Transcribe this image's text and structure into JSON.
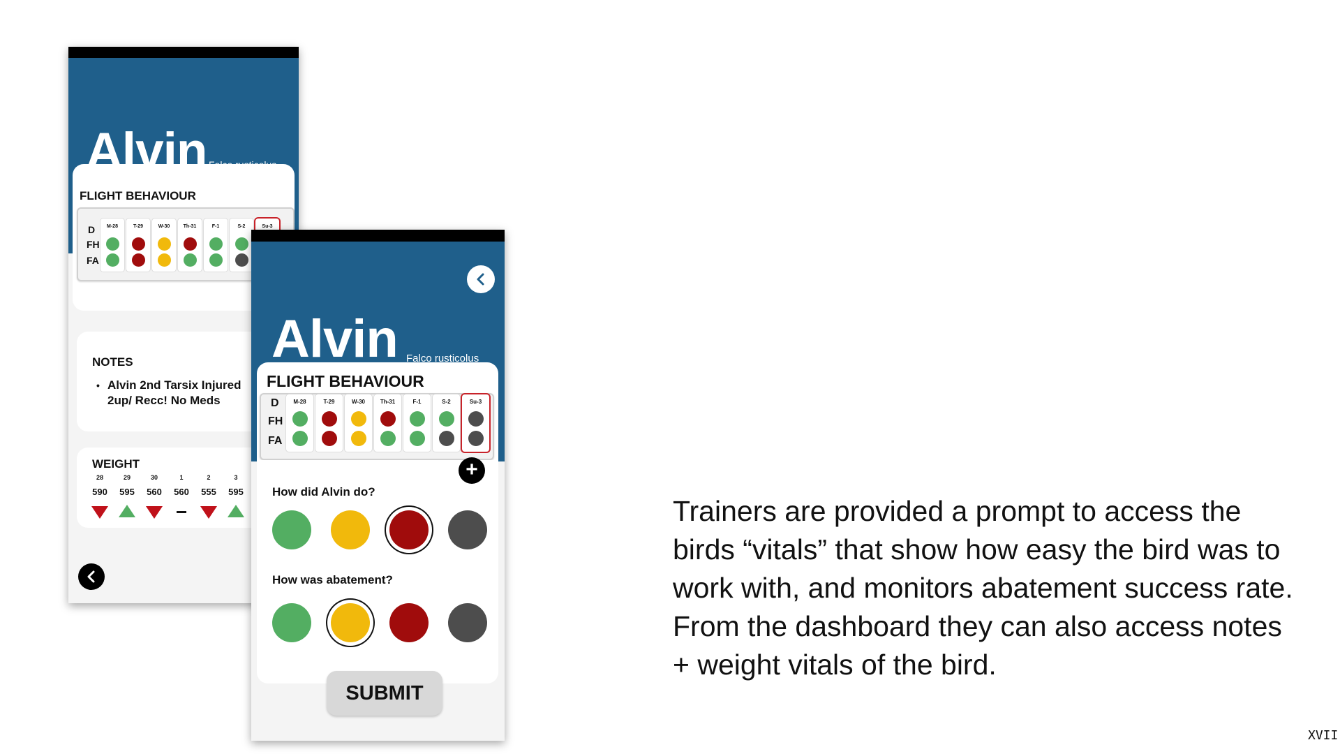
{
  "back_screen": {
    "bird_name": "Alvin",
    "scientific_name": "Falco rusticolus",
    "flight_behaviour": {
      "title": "FLIGHT BEHAVIOUR",
      "row_labels": [
        "D",
        "FH",
        "FA"
      ],
      "days": [
        {
          "label": "M-28",
          "fh": "green",
          "fa": "green"
        },
        {
          "label": "T-29",
          "fh": "red",
          "fa": "red"
        },
        {
          "label": "W-30",
          "fh": "yellow",
          "fa": "yellow"
        },
        {
          "label": "Th-31",
          "fh": "red",
          "fa": "green"
        },
        {
          "label": "F-1",
          "fh": "green",
          "fa": "green"
        },
        {
          "label": "S-2",
          "fh": "green",
          "fa": "gray"
        },
        {
          "label": "Su-3",
          "fh": "gray",
          "fa": "gray"
        }
      ]
    },
    "notes": {
      "title": "NOTES",
      "items": [
        "Alvin 2nd Tarsix Injured 2up/ Recc! No Meds"
      ]
    },
    "weight": {
      "title": "WEIGHT",
      "entries": [
        {
          "day": "28",
          "value": "590",
          "trend": "down"
        },
        {
          "day": "29",
          "value": "595",
          "trend": "up"
        },
        {
          "day": "30",
          "value": "560",
          "trend": "down"
        },
        {
          "day": "1",
          "value": "560",
          "trend": "same"
        },
        {
          "day": "2",
          "value": "555",
          "trend": "down"
        },
        {
          "day": "3",
          "value": "595",
          "trend": "up"
        }
      ]
    },
    "back_icon": "chevron-left-icon"
  },
  "front_screen": {
    "bird_name": "Alvin",
    "scientific_name": "Falco rusticolus",
    "flight_behaviour": {
      "title": "FLIGHT BEHAVIOUR",
      "row_labels": [
        "D",
        "FH",
        "FA"
      ],
      "days": [
        {
          "label": "M-28",
          "fh": "green",
          "fa": "green"
        },
        {
          "label": "T-29",
          "fh": "red",
          "fa": "red"
        },
        {
          "label": "W-30",
          "fh": "yellow",
          "fa": "yellow"
        },
        {
          "label": "Th-31",
          "fh": "red",
          "fa": "green"
        },
        {
          "label": "F-1",
          "fh": "green",
          "fa": "green"
        },
        {
          "label": "S-2",
          "fh": "green",
          "fa": "gray"
        },
        {
          "label": "Su-3",
          "fh": "gray",
          "fa": "gray"
        }
      ]
    },
    "add_icon": "plus-icon",
    "back_icon": "chevron-left-icon",
    "question1": {
      "label": "How did Alvin do?",
      "options": [
        "green",
        "yellow",
        "red",
        "gray"
      ],
      "selected": "red"
    },
    "question2": {
      "label": "How was abatement?",
      "options": [
        "green",
        "yellow",
        "red",
        "gray"
      ],
      "selected": "yellow"
    },
    "submit_label": "SUBMIT"
  },
  "colors": {
    "header": "#1f5f8b",
    "green": "#53ae62",
    "yellow": "#f1b90c",
    "red": "#a00c0c",
    "gray": "#4d4d4d",
    "today_border": "#c8232a"
  },
  "caption": "Trainers are provided a prompt to access the birds “vitals” that show how easy the bird was to work with, and monitors abatement success rate. From the dashboard they can also access notes + weight vitals of the bird.",
  "page_number": "XVII"
}
